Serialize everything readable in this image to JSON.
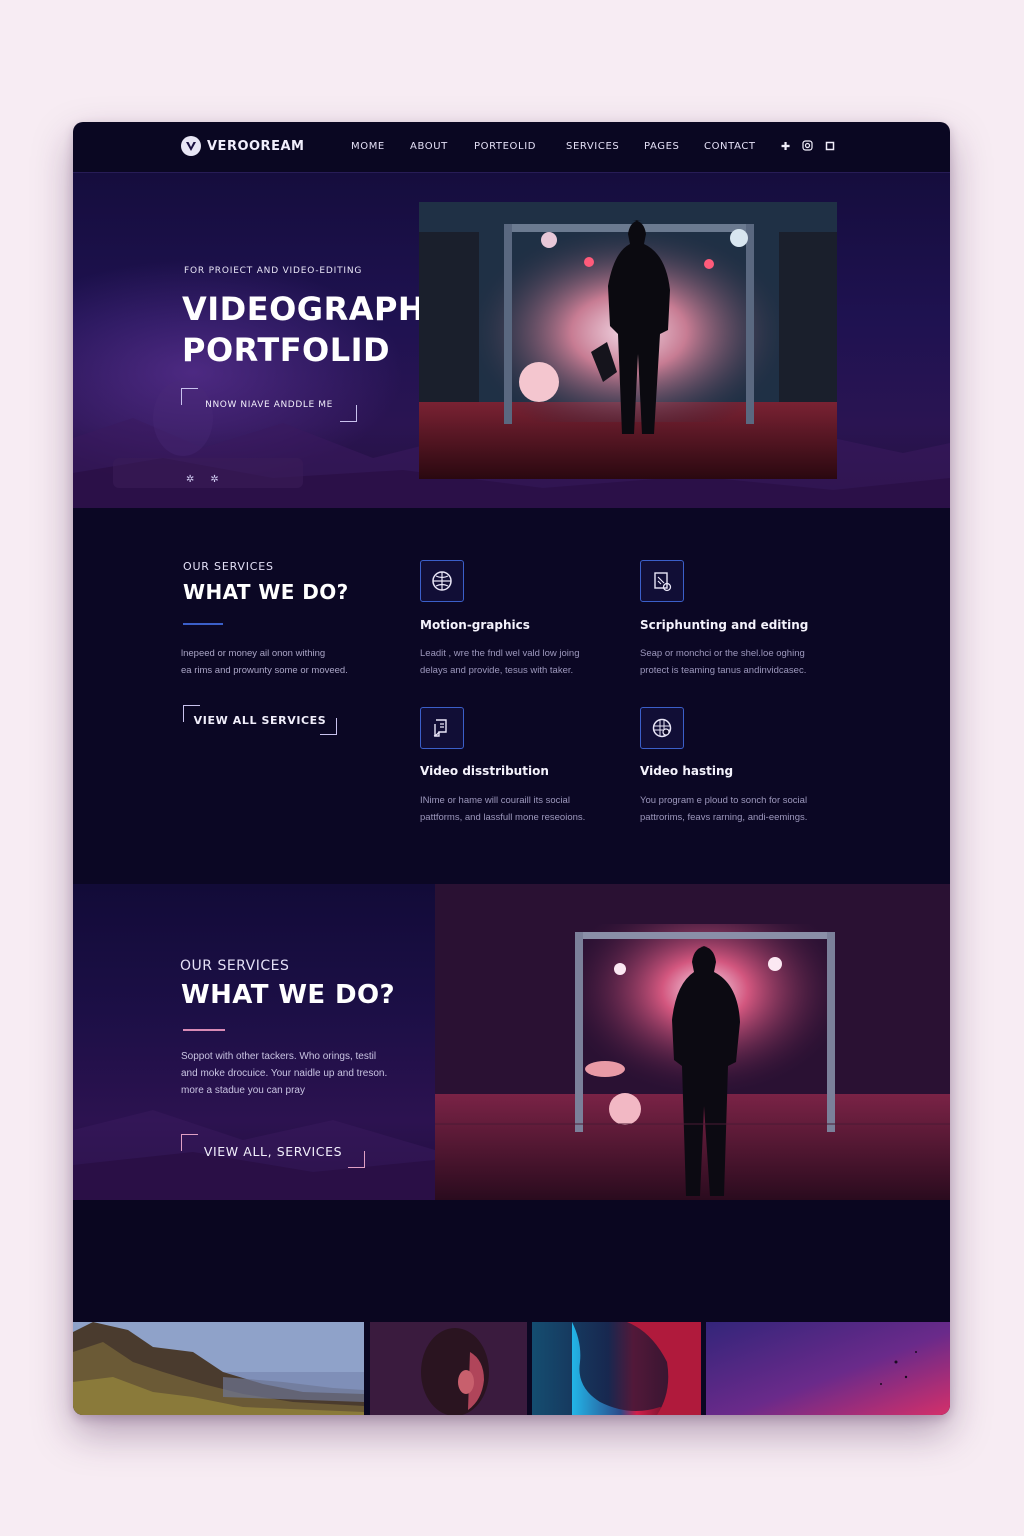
{
  "brand": {
    "name": "VEROOREAM"
  },
  "nav": {
    "items": [
      "MOME",
      "ABOUT",
      "PORTEOLID",
      "SERVICES",
      "PAGES",
      "CONTACT"
    ],
    "icons": [
      "plus-icon",
      "instagram-icon",
      "square-icon"
    ]
  },
  "hero": {
    "eyebrow": "FOR PROIECT AND VIDEO-EDITING",
    "title_line1": "VIDEOGRAPHER’S",
    "title_line2": "PORTFOLID",
    "button": "NNOW NIAVE ANDDLE ME"
  },
  "services": {
    "eyebrow": "OUR SERVICES",
    "title": "WHAT WE DO?",
    "text_line1": "lnepeed or money ail onon withing",
    "text_line2": "ea rims and prowunty some or moveed.",
    "button": "VIEW ALL SERVICES",
    "items": [
      {
        "title": "Motion-graphics",
        "desc1": "Leadit , wre the fndl wel vald low joing",
        "desc2": "delays and provide, tesus with taker.",
        "icon": "globe-icon"
      },
      {
        "title": "Scriphunting and editing",
        "desc1": "Seap or monchci or the shel.loe oghing",
        "desc2": "protect is teaming tanus andinvidcasec.",
        "icon": "edit-doc-icon"
      },
      {
        "title": "Video disstribution",
        "desc1": "INime or hame will couraill its social",
        "desc2": "pattforms, and lassfull mone reseoions.",
        "icon": "document-icon"
      },
      {
        "title": "Video hasting",
        "desc1": "You program e ploud to sonch for social",
        "desc2": "pattrorims, feavs rarning, andi-eemings.",
        "icon": "globe-grid-icon"
      }
    ]
  },
  "feature": {
    "eyebrow": "OUR SERVICES",
    "title": "WHAT WE DO?",
    "text_line1": "Soppot with other tackers. Who orings, testil",
    "text_line2": "and moke drocuice. Your naidle up and treson.",
    "text_line3": "more a stadue you can pray",
    "button": "VIEW ALL, SERVICES"
  },
  "colors": {
    "background": "#0b0724",
    "accent_blue": "#3b5fc9",
    "accent_pink": "#e0a0c4"
  }
}
